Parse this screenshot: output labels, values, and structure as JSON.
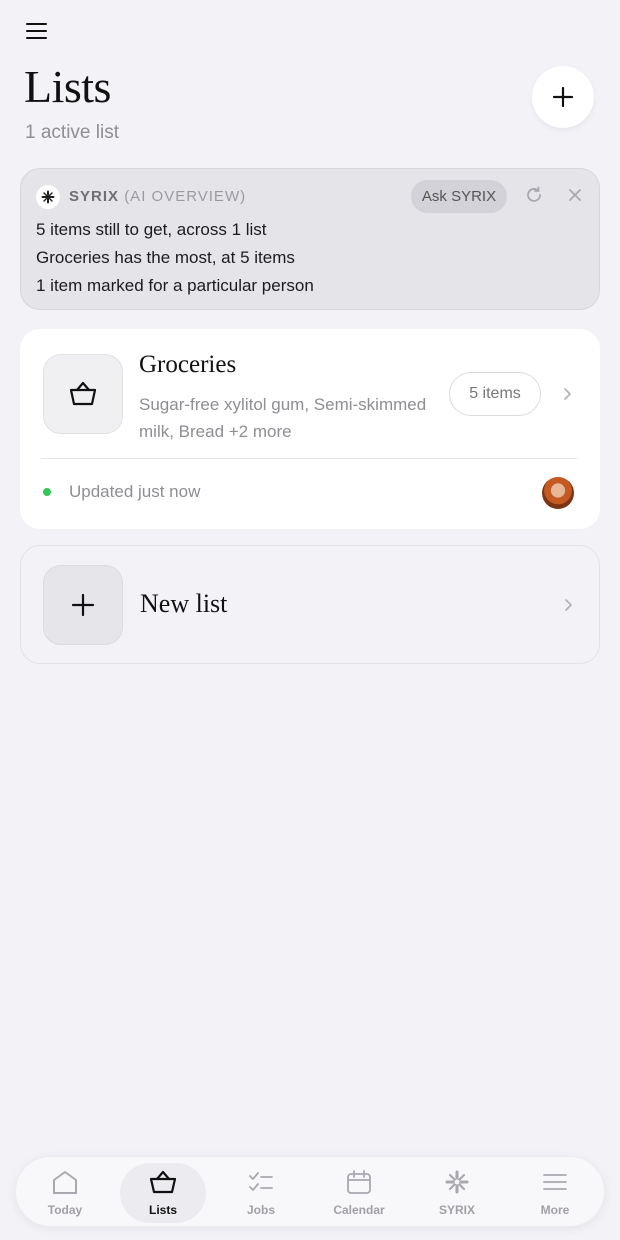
{
  "header": {
    "title": "Lists",
    "subtitle": "1 active list"
  },
  "ai_overview": {
    "brand": "SYRIX",
    "brand_sub": "(AI OVERVIEW)",
    "ask_label": "Ask SYRIX",
    "lines": [
      "5 items still to get, across 1 list",
      "Groceries has the most, at 5 items",
      "1 item marked for a particular person"
    ]
  },
  "lists": [
    {
      "name": "Groceries",
      "icon": "basket-icon",
      "preview": "Sugar-free xylitol gum, Semi-skimmed milk, Bread +2 more",
      "items_label": "5 items",
      "status": "Updated just now",
      "status_color": "#34c759"
    }
  ],
  "new_list": {
    "label": "New list"
  },
  "nav": {
    "items": [
      {
        "label": "Today",
        "icon": "home-icon"
      },
      {
        "label": "Lists",
        "icon": "basket-icon",
        "active": true
      },
      {
        "label": "Jobs",
        "icon": "checklist-icon"
      },
      {
        "label": "Calendar",
        "icon": "calendar-icon"
      },
      {
        "label": "SYRIX",
        "icon": "syrix-icon"
      },
      {
        "label": "More",
        "icon": "more-icon"
      }
    ]
  },
  "colors": {
    "background": "#f2f2f7",
    "accent_green": "#34c759"
  }
}
